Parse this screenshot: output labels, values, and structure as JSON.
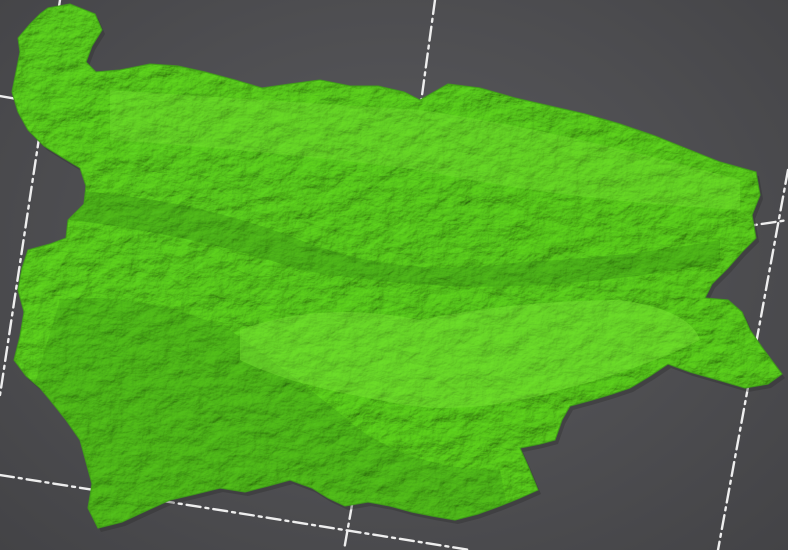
{
  "viewer": {
    "background_color": "#4f4f52",
    "bed_grid_color": "#eeeeee",
    "model_color": "#5fd620",
    "model_shadow_color": "#2f7a12",
    "model_highlight_color": "#86f03e"
  }
}
